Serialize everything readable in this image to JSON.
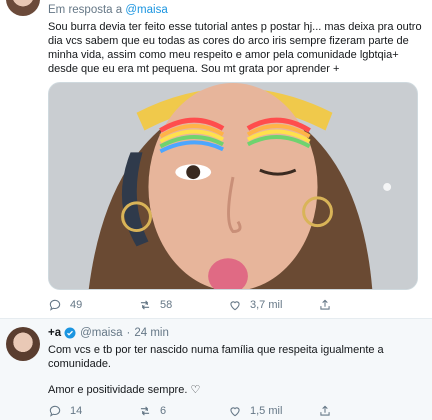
{
  "main_tweet": {
    "reply_prefix": "Em resposta a",
    "reply_handle": "@maisa",
    "text": "Sou burra devia ter feito esse tutorial antes p postar hj... mas deixa pra outro dia vcs sabem que eu todas as cores do arco iris sempre fizeram parte de minha vida, assim como meu respeito e amor pela comunidade lgbtqia+ desde que eu era mt pequena. Sou mt grata por aprender +",
    "actions": {
      "replies": "49",
      "retweets": "58",
      "likes": "3,7 mil"
    }
  },
  "reply_tweet": {
    "name": "+a",
    "handle": "@maisa",
    "separator": "·",
    "time": "24 min",
    "line1": "Com vcs e tb por ter nascido numa família que respeita igualmente a comunidade.",
    "line2": "Amor e positividade sempre. ♡",
    "actions": {
      "replies": "14",
      "retweets": "6",
      "likes": "1,5 mil"
    }
  },
  "colors": {
    "accent": "#1b95e0",
    "muted": "#657786",
    "text": "#14171a",
    "reply_bg": "#f5f8fa"
  },
  "icons": [
    "reply-icon",
    "retweet-icon",
    "like-icon",
    "share-icon",
    "verified-icon"
  ]
}
